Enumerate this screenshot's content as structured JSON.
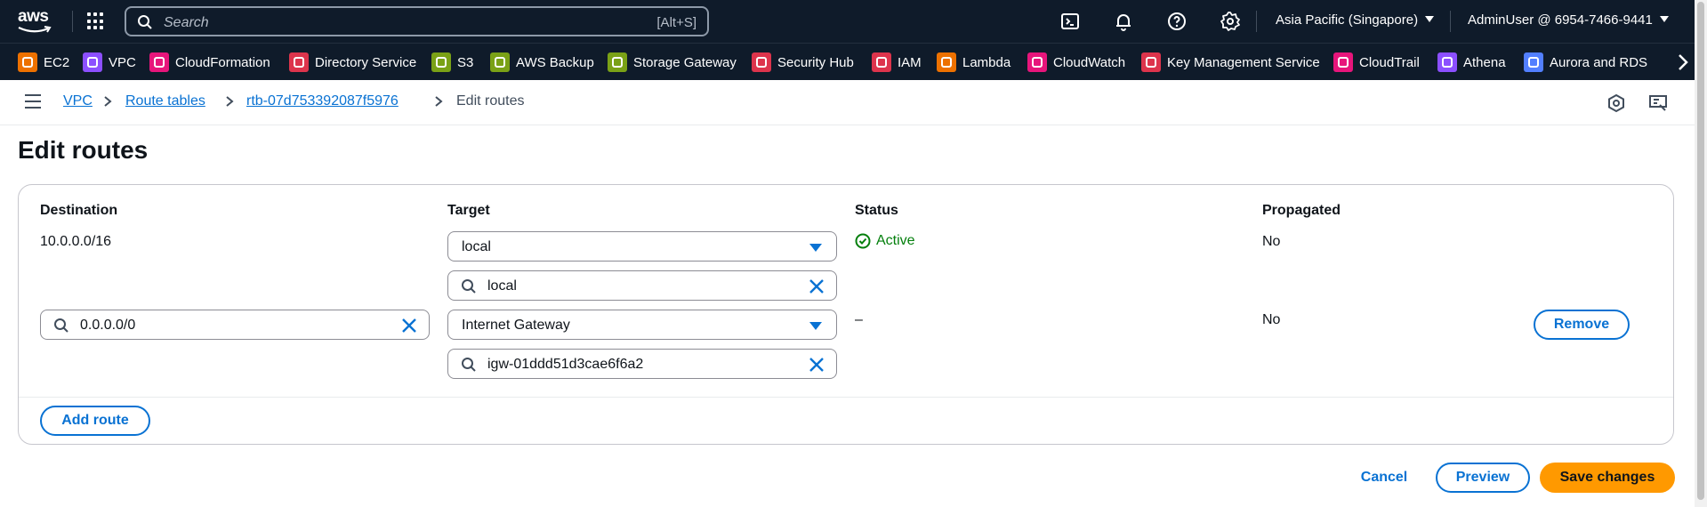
{
  "topnav": {
    "logo_text": "aws",
    "search_placeholder": "Search",
    "search_shortcut": "[Alt+S]",
    "icons": [
      "cloudshell-icon",
      "bell-icon",
      "help-icon",
      "gear-icon"
    ],
    "region": "Asia Pacific (Singapore)",
    "account": "AdminUser @ 6954-7466-9441"
  },
  "services": [
    {
      "label": "EC2",
      "color": "#ed7100"
    },
    {
      "label": "VPC",
      "color": "#8c4fff"
    },
    {
      "label": "CloudFormation",
      "color": "#e7157b"
    },
    {
      "label": "Directory Service",
      "color": "#dd344c"
    },
    {
      "label": "S3",
      "color": "#7aa116"
    },
    {
      "label": "AWS Backup",
      "color": "#7aa116"
    },
    {
      "label": "Storage Gateway",
      "color": "#7aa116"
    },
    {
      "label": "Security Hub",
      "color": "#dd344c"
    },
    {
      "label": "IAM",
      "color": "#dd344c"
    },
    {
      "label": "Lambda",
      "color": "#ed7100"
    },
    {
      "label": "CloudWatch",
      "color": "#e7157b"
    },
    {
      "label": "Key Management Service",
      "color": "#dd344c"
    },
    {
      "label": "CloudTrail",
      "color": "#e7157b"
    },
    {
      "label": "Athena",
      "color": "#8c4fff"
    },
    {
      "label": "Aurora and RDS",
      "color": "#527fff"
    }
  ],
  "breadcrumb": {
    "items": [
      "VPC",
      "Route tables",
      "rtb-07d753392087f5976"
    ],
    "current": "Edit routes"
  },
  "page": {
    "title": "Edit routes"
  },
  "table": {
    "headers": {
      "destination": "Destination",
      "target": "Target",
      "status": "Status",
      "propagated": "Propagated"
    },
    "rows": [
      {
        "destination": "10.0.0.0/16",
        "target_select": "local",
        "target_search": "local",
        "status": "Active",
        "propagated": "No"
      },
      {
        "destination": "0.0.0.0/0",
        "target_select": "Internet Gateway",
        "target_search": "igw-01ddd51d3cae6f6a2",
        "status": "–",
        "propagated": "No",
        "remove_label": "Remove"
      }
    ],
    "add_route_label": "Add route"
  },
  "actions": {
    "cancel": "Cancel",
    "preview": "Preview",
    "save": "Save changes"
  },
  "colors": {
    "nav_bg": "#0f1b2a",
    "link": "#0972d3",
    "success": "#037f0c",
    "primary": "#ff9900"
  }
}
